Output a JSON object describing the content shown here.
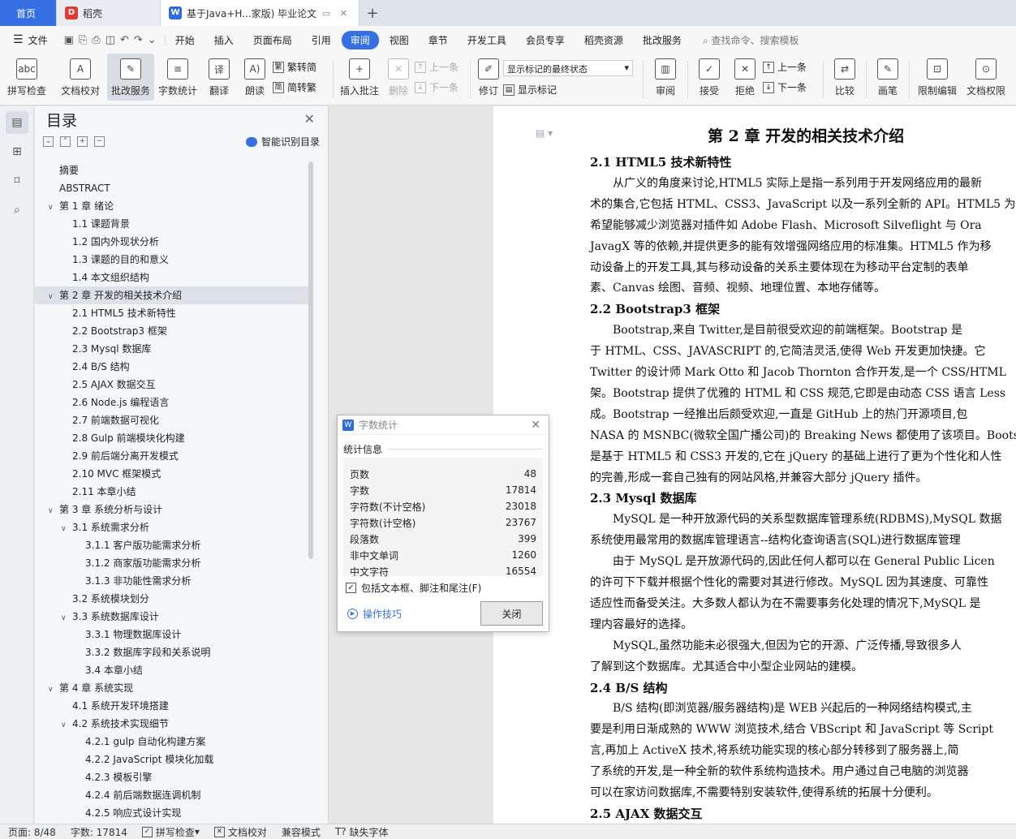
{
  "tabs": [
    {
      "label": "首页"
    },
    {
      "label": "稻壳",
      "icon": "docer-icon"
    },
    {
      "label": "基于Java+H...家版)  毕业论文",
      "icon": "wps-writer-icon"
    }
  ],
  "menu": {
    "file": "文件",
    "items": [
      "开始",
      "插入",
      "页面布局",
      "引用",
      "审阅",
      "视图",
      "章节",
      "开发工具",
      "会员专享",
      "稻壳资源",
      "批改服务"
    ],
    "active": "审阅",
    "search": "查找命令、搜索模板"
  },
  "ribbon": {
    "spellcheck": "拼写检查",
    "doccheck": "文档校对",
    "correction": "批改服务",
    "wordcount": "字数统计",
    "translate": "翻译",
    "read": "朗读",
    "trad": "繁转简",
    "simp": "简转繁",
    "insert_comment": "插入批注",
    "delete": "删除",
    "prev": "上一条",
    "next": "下一条",
    "revise": "修订",
    "markup_mode": "显示标记的最终状态",
    "show_markup": "显示标记",
    "review": "审阅",
    "accept": "接受",
    "reject": "拒绝",
    "prev2": "上一条",
    "next2": "下一条",
    "compare": "比较",
    "draw": "画笔",
    "restrict": "限制编辑",
    "docperm": "文档权限"
  },
  "toc": {
    "title": "目录",
    "smart": "智能识别目录",
    "items": [
      {
        "text": "摘要",
        "level": 0,
        "arrow": ""
      },
      {
        "text": "ABSTRACT",
        "level": 0,
        "arrow": ""
      },
      {
        "text": "第 1 章  绪论",
        "level": 0,
        "arrow": "v"
      },
      {
        "text": "1.1  课题背景",
        "level": 1,
        "arrow": ""
      },
      {
        "text": "1.2  国内外现状分析",
        "level": 1,
        "arrow": ""
      },
      {
        "text": "1.3  课题的目的和意义",
        "level": 1,
        "arrow": ""
      },
      {
        "text": "1.4  本文组织结构",
        "level": 1,
        "arrow": ""
      },
      {
        "text": "第 2 章  开发的相关技术介绍",
        "level": 0,
        "arrow": "v",
        "selected": true
      },
      {
        "text": "2.1 HTML5 技术新特性",
        "level": 1,
        "arrow": ""
      },
      {
        "text": "2.2 Bootstrap3 框架",
        "level": 1,
        "arrow": ""
      },
      {
        "text": "2.3 Mysql 数据库",
        "level": 1,
        "arrow": ""
      },
      {
        "text": "2.4 B/S 结构",
        "level": 1,
        "arrow": ""
      },
      {
        "text": "2.5 AJAX 数据交互",
        "level": 1,
        "arrow": ""
      },
      {
        "text": "2.6 Node.js 编程语言",
        "level": 1,
        "arrow": ""
      },
      {
        "text": "2.7 前端数据可视化",
        "level": 1,
        "arrow": ""
      },
      {
        "text": "2.8 Gulp 前端模块化构建",
        "level": 1,
        "arrow": ""
      },
      {
        "text": "2.9 前后端分离开发模式",
        "level": 1,
        "arrow": ""
      },
      {
        "text": "2.10 MVC 框架模式",
        "level": 1,
        "arrow": ""
      },
      {
        "text": "2.11  本章小结",
        "level": 1,
        "arrow": ""
      },
      {
        "text": "第 3 章  系统分析与设计",
        "level": 0,
        "arrow": "v"
      },
      {
        "text": "3.1  系统需求分析",
        "level": 1,
        "arrow": "v"
      },
      {
        "text": "3.1.1  客户版功能需求分析",
        "level": 2,
        "arrow": ""
      },
      {
        "text": "3.1.2  商家版功能需求分析",
        "level": 2,
        "arrow": ""
      },
      {
        "text": "3.1.3  非功能性需求分析",
        "level": 2,
        "arrow": ""
      },
      {
        "text": "3.2  系统模块划分",
        "level": 1,
        "arrow": ""
      },
      {
        "text": "3.3  系统数据库设计",
        "level": 1,
        "arrow": "v"
      },
      {
        "text": "3.3.1 物理数据库设计",
        "level": 2,
        "arrow": ""
      },
      {
        "text": "3.3.2  数据库字段和关系说明",
        "level": 2,
        "arrow": ""
      },
      {
        "text": "3.4  本章小结",
        "level": 2,
        "arrow": ""
      },
      {
        "text": "第 4 章  系统实现",
        "level": 0,
        "arrow": "v"
      },
      {
        "text": "4.1  系统开发环境搭建",
        "level": 1,
        "arrow": ""
      },
      {
        "text": "4.2  系统技术实现细节",
        "level": 1,
        "arrow": "v"
      },
      {
        "text": "4.2.1 gulp 自动化构建方案",
        "level": 2,
        "arrow": ""
      },
      {
        "text": "4.2.2 JavaScript 模块化加载",
        "level": 2,
        "arrow": ""
      },
      {
        "text": "4.2.3  模板引擎",
        "level": 2,
        "arrow": ""
      },
      {
        "text": "4.2.4  前后端数据连调机制",
        "level": 2,
        "arrow": ""
      },
      {
        "text": "4.2.5  响应式设计实现",
        "level": 2,
        "arrow": ""
      }
    ]
  },
  "document": {
    "chapter_title": "第 2 章  开发的相关技术介绍",
    "lines": [
      {
        "t": "2.1 HTML5 技术新特性",
        "h": true,
        "indent": false
      },
      {
        "t": "从广义的角度来讨论,HTML5 实际上是指一系列用于开发网络应用的最新",
        "h": false,
        "indent": true
      },
      {
        "t": "术的集合,它包括 HTML、CSS3、JavaScript 以及一系列全新的 API。HTML5 为",
        "h": false,
        "indent": false
      },
      {
        "t": "希望能够减少浏览器对插件如 Adobe Flash、Microsoft Silveflight 与 Ora",
        "h": false,
        "indent": false
      },
      {
        "t": "JavagX 等的依赖,并提供更多的能有效增强网络应用的标准集。HTML5 作为移",
        "h": false,
        "indent": false
      },
      {
        "t": "动设备上的开发工具,其与移动设备的关系主要体现在为移动平台定制的表单",
        "h": false,
        "indent": false
      },
      {
        "t": "素、Canvas 绘图、音频、视频、地理位置、本地存储等。",
        "h": false,
        "indent": false
      },
      {
        "t": "2.2 Bootstrap3 框架",
        "h": true,
        "indent": false
      },
      {
        "t": "Bootstrap,来自 Twitter,是目前很受欢迎的前端框架。Bootstrap 是",
        "h": false,
        "indent": true
      },
      {
        "t": "于 HTML、CSS、JAVASCRIPT 的,它简洁灵活,使得 Web 开发更加快捷。它",
        "h": false,
        "indent": false
      },
      {
        "t": "Twitter 的设计师 Mark Otto 和 Jacob Thornton 合作开发,是一个 CSS/HTML",
        "h": false,
        "indent": false
      },
      {
        "t": "架。Bootstrap 提供了优雅的 HTML 和 CSS 规范,它即是由动态 CSS 语言 Less",
        "h": false,
        "indent": false
      },
      {
        "t": "成。Bootstrap 一经推出后颇受欢迎,一直是 GitHub 上的热门开源项目,包",
        "h": false,
        "indent": false
      },
      {
        "t": "NASA 的 MSNBC(微软全国广播公司)的 Breaking News 都使用了该项目。Bootst",
        "h": false,
        "indent": false
      },
      {
        "t": "是基于 HTML5 和 CSS3 开发的,它在 jQuery 的基础上进行了更为个性化和人性",
        "h": false,
        "indent": false
      },
      {
        "t": "的完善,形成一套自己独有的网站风格,并兼容大部分 jQuery 插件。",
        "h": false,
        "indent": false
      },
      {
        "t": "2.3 Mysql 数据库",
        "h": true,
        "indent": false
      },
      {
        "t": "MySQL 是一种开放源代码的关系型数据库管理系统(RDBMS),MySQL 数据",
        "h": false,
        "indent": true
      },
      {
        "t": "系统使用最常用的数据库管理语言--结构化查询语言(SQL)进行数据库管理",
        "h": false,
        "indent": false
      },
      {
        "t": "由于 MySQL 是开放源代码的,因此任何人都可以在 General Public Licen",
        "h": false,
        "indent": true
      },
      {
        "t": "的许可下下载并根据个性化的需要对其进行修改。MySQL 因为其速度、可靠性",
        "h": false,
        "indent": false
      },
      {
        "t": "适应性而备受关注。大多数人都认为在不需要事务化处理的情况下,MySQL 是",
        "h": false,
        "indent": false
      },
      {
        "t": "理内容最好的选择。",
        "h": false,
        "indent": false
      },
      {
        "t": "MySQL,虽然功能未必很强大,但因为它的开源、广泛传播,导致很多人",
        "h": false,
        "indent": true
      },
      {
        "t": "了解到这个数据库。尤其适合中小型企业网站的建模。",
        "h": false,
        "indent": false
      },
      {
        "t": "2.4 B/S 结构",
        "h": true,
        "indent": false
      },
      {
        "t": "B/S 结构(即浏览器/服务器结构)是 WEB 兴起后的一种网络结构模式,主",
        "h": false,
        "indent": true
      },
      {
        "t": "要是利用日渐成熟的 WWW 浏览技术,结合 VBScript 和 JavaScript 等 Script",
        "h": false,
        "indent": false
      },
      {
        "t": "言,再加上 ActiveX 技术,将系统功能实现的核心部分转移到了服务器上,简",
        "h": false,
        "indent": false
      },
      {
        "t": "了系统的开发,是一种全新的软件系统构造技术。用户通过自己电脑的浏览器",
        "h": false,
        "indent": false
      },
      {
        "t": "可以在家访问数据库,不需要特别安装软件,使得系统的拓展十分便利。",
        "h": false,
        "indent": false
      },
      {
        "t": "2.5 AJAX 数据交互",
        "h": true,
        "indent": false
      }
    ]
  },
  "dialog": {
    "title": "字数统计",
    "section": "统计信息",
    "rows": [
      {
        "label": "页数",
        "value": "48"
      },
      {
        "label": "字数",
        "value": "17814"
      },
      {
        "label": "字符数(不计空格)",
        "value": "23018"
      },
      {
        "label": "字符数(计空格)",
        "value": "23767"
      },
      {
        "label": "段落数",
        "value": "399"
      },
      {
        "label": "非中文单词",
        "value": "1260"
      },
      {
        "label": "中文字符",
        "value": "16554"
      }
    ],
    "include_label": "包括文本框、脚注和尾注(F)",
    "include_checked": true,
    "tips": "操作技巧",
    "close": "关闭"
  },
  "status": {
    "page": "页面: 8/48",
    "words": "字数: 17814",
    "spell": "拼写检查",
    "doccheck": "文档校对",
    "compat": "兼容模式",
    "missing_font": "缺失字体"
  },
  "colors": {
    "accent": "#3470e4",
    "home_tab": "#3470e4"
  }
}
